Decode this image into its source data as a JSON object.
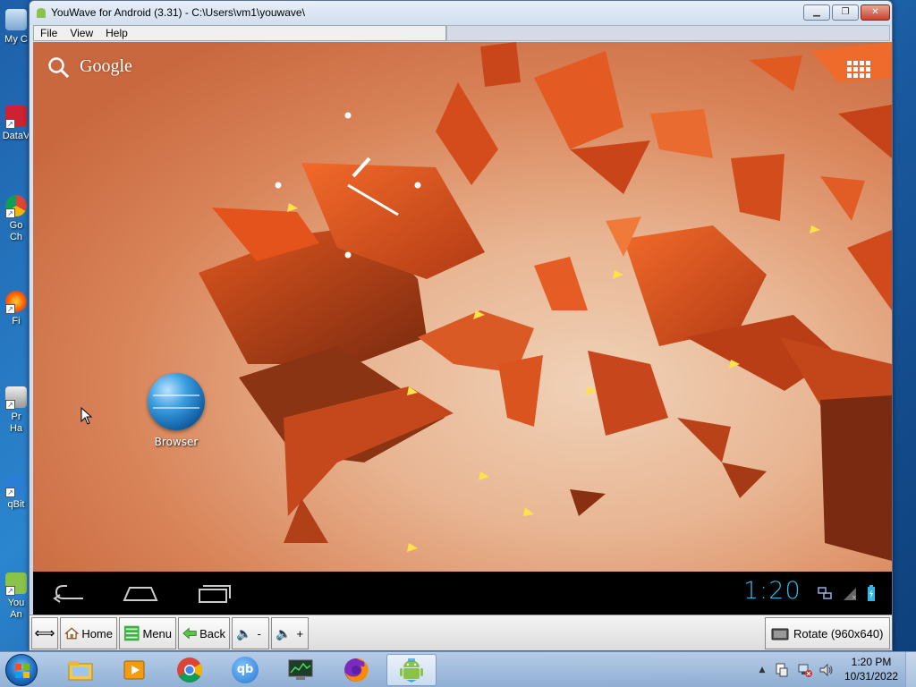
{
  "desktop": {
    "icons": [
      {
        "label": "My C",
        "icon": "computer-icon"
      },
      {
        "label": "DataV",
        "icon": "data-icon"
      },
      {
        "label": "Go\nCh",
        "icon": "chrome-icon"
      },
      {
        "label": "Fi",
        "icon": "firefox-icon"
      },
      {
        "label": "Pr\nHa",
        "icon": "program-icon"
      },
      {
        "label": "qBit",
        "icon": "qbittorrent-icon"
      },
      {
        "label": "You\nAn",
        "icon": "youwave-icon"
      }
    ]
  },
  "window": {
    "title": "YouWave for Android (3.31) - C:\\Users\\vm1\\youwave\\",
    "menu": [
      "File",
      "View",
      "Help"
    ],
    "buttons": {
      "minimize": "minimize-icon",
      "maximize": "maximize-icon",
      "close": "close-icon"
    }
  },
  "android": {
    "search_label": "Google",
    "shortcut": {
      "label": "Browser",
      "icon": "browser-globe-icon"
    },
    "clock": "1:20",
    "nav": [
      "back-icon",
      "home-icon",
      "recent-apps-icon"
    ]
  },
  "toolbar": {
    "home": "Home",
    "menu": "Menu",
    "back": "Back",
    "vol_down": "-",
    "vol_up": "+",
    "rotate": "Rotate (960x640)"
  },
  "taskbar": {
    "apps": [
      "file-explorer-icon",
      "media-player-icon",
      "chrome-icon",
      "qbittorrent-icon",
      "task-manager-icon",
      "firefox-icon",
      "youwave-android-icon"
    ],
    "qb_text": "qb",
    "time": "1:20 PM",
    "date": "10/31/2022"
  },
  "colors": {
    "android_accent": "#33b5e5",
    "wallpaper_base": "#d47a52",
    "shard_dark": "#c0421a",
    "shard_light": "#f06a2a"
  }
}
